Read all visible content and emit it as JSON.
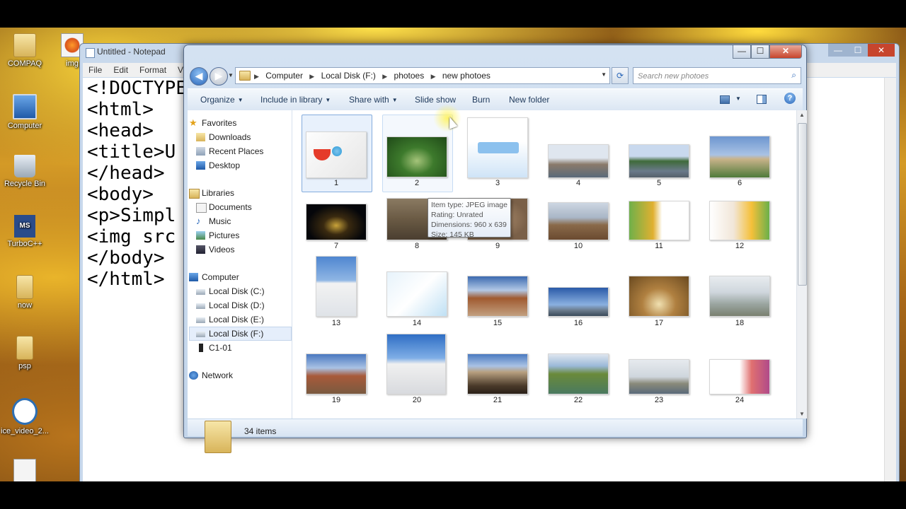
{
  "desktop": {
    "icons": [
      {
        "label": "COMPAQ",
        "icon": "folder-icon"
      },
      {
        "label": "img",
        "icon": "firefox-icon"
      },
      {
        "label": "Computer",
        "icon": "computer-icon"
      },
      {
        "label": "Recycle Bin",
        "icon": "recycle-bin-icon"
      },
      {
        "label": "TurboC++",
        "icon": "ms-dos-icon"
      },
      {
        "label": "now",
        "icon": "folder-icon"
      },
      {
        "label": "psp",
        "icon": "folder-icon"
      },
      {
        "label": "ice_video_2...",
        "icon": "video-icon"
      }
    ]
  },
  "notepad": {
    "title": "Untitled - Notepad",
    "menu": [
      "File",
      "Edit",
      "Format",
      "View"
    ],
    "lines": [
      "<!DOCTYPE",
      "<html>",
      "<head>",
      "<title>U",
      "</head>",
      "<body>",
      "<p>Simpl",
      "<img src",
      "</body>",
      "</html>"
    ]
  },
  "explorer": {
    "window_controls": {
      "minimize": "—",
      "maximize": "☐",
      "close": "✕"
    },
    "breadcrumb": [
      "Computer",
      "Local Disk (F:)",
      "photoes",
      "new photoes"
    ],
    "search_placeholder": "Search new photoes",
    "toolbar": {
      "organize": "Organize",
      "include_in_library": "Include in library",
      "share_with": "Share with",
      "slide_show": "Slide show",
      "burn": "Burn",
      "new_folder": "New folder"
    },
    "nav": {
      "favorites": "Favorites",
      "favorites_items": [
        "Downloads",
        "Recent Places",
        "Desktop"
      ],
      "libraries": "Libraries",
      "libraries_items": [
        "Documents",
        "Music",
        "Pictures",
        "Videos"
      ],
      "computer": "Computer",
      "computer_items": [
        "Local Disk (C:)",
        "Local Disk (D:)",
        "Local Disk (E:)",
        "Local Disk (F:)",
        "C1-01"
      ],
      "network": "Network"
    },
    "thumbnails": [
      "1",
      "2",
      "3",
      "4",
      "5",
      "6",
      "7",
      "8",
      "9",
      "10",
      "11",
      "12",
      "13",
      "14",
      "15",
      "16",
      "17",
      "18",
      "19",
      "20",
      "21",
      "22",
      "23",
      "24"
    ],
    "selected_item": "1",
    "hovered_item": "2",
    "tooltip": {
      "type": "Item type: JPEG image",
      "rating": "Rating: Unrated",
      "dimensions": "Dimensions: 960 x 639",
      "size": "Size: 145 KB"
    },
    "status": {
      "count": "34 items"
    }
  },
  "colors": {
    "accent": "#2a66b8",
    "selection": "#e8f1fc"
  }
}
